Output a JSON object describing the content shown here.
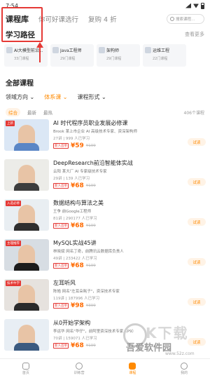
{
  "status": {
    "time": "7:54"
  },
  "header": {
    "tabs": [
      {
        "label": "课程库"
      },
      {
        "label": "你可好课选行"
      },
      {
        "label": "复购 4 折"
      }
    ],
    "search_placeholder": "搜索课程..."
  },
  "paths": {
    "title": "学习路径",
    "see_more": "查看更多",
    "cards": [
      {
        "name": "AI大模型前沿...",
        "count": "33门课程"
      },
      {
        "name": "Java工程师",
        "count": "29门课程"
      },
      {
        "name": "架构师",
        "count": "29门课程"
      },
      {
        "name": "运维工程",
        "count": "22门课程"
      }
    ]
  },
  "all_courses": {
    "title": "全部课程",
    "filters": [
      {
        "label": "领域方向 ⌄",
        "active": false
      },
      {
        "label": "体系课 ⌄",
        "active": true
      },
      {
        "label": "课程形式 ⌄",
        "active": false
      }
    ],
    "sort": [
      "综合",
      "最新",
      "最热"
    ],
    "count": "406个课程"
  },
  "courses": [
    {
      "title": "AI 时代程序员职业发展必修课",
      "teacher": "Brook  某上市企业 AI 高级技术专家、资深架构师",
      "meta": "27讲 | 999 人已学习",
      "badge": "新人首单",
      "price": "¥59",
      "orig": "¥199",
      "try": "试读",
      "tag": "上新",
      "colors": [
        "#dbe7f5",
        "#5a86c6"
      ]
    },
    {
      "title": "DeepResearch前沿智能体实战",
      "teacher": "云阳  某大厂 AI 专家级技术专家",
      "meta": "29讲 | 139 人已学习",
      "badge": "新人首单",
      "price": "¥68",
      "orig": "¥199",
      "try": "试读",
      "tag": "",
      "colors": [
        "#ecece8",
        "#3d3d3d"
      ]
    },
    {
      "title": "数据结构与算法之美",
      "teacher": "王争  前Google工程师",
      "meta": "81讲 | 290177 人已学习",
      "badge": "新人首单",
      "price": "¥68",
      "orig": "¥199",
      "try": "试读",
      "tag": "入选必修",
      "colors": [
        "#e9eef2",
        "#2f2f2f"
      ]
    },
    {
      "title": "MySQL实战45讲",
      "teacher": "林晓斌  网名丁奇，前腾讯云数据库负责人",
      "meta": "49讲 | 233422 人已学习",
      "badge": "新人首单",
      "price": "¥68",
      "orig": "¥199",
      "try": "试读",
      "tag": "主理推荐",
      "colors": [
        "#d7dde3",
        "#1c1c1c"
      ]
    },
    {
      "title": "左耳听风",
      "teacher": "陈皓  网名\"左耳朵耗子\"，资深技术专家",
      "meta": "119讲 | 187996 人已学习",
      "badge": "新人首单",
      "price": "¥98",
      "orig": "¥399",
      "try": "试读",
      "tag": "技术牛学",
      "colors": [
        "#e6e2de",
        "#2b2b2b"
      ]
    },
    {
      "title": "从0开始学架构",
      "teacher": "李运华  网名\"华仔\"，前阿里资深技术专家（P9）",
      "meta": "70讲 | 159071 人已学习",
      "badge": "新人首单",
      "price": "¥68",
      "orig": "¥199",
      "try": "试读",
      "tag": "",
      "colors": [
        "#e8eef4",
        "#3b5a80"
      ]
    }
  ],
  "bottom_nav": [
    {
      "label": "首页",
      "active": false
    },
    {
      "label": "训练营",
      "active": false
    },
    {
      "label": "课程",
      "active": true
    },
    {
      "label": "我的",
      "active": false
    }
  ],
  "watermark": {
    "big": "K下载",
    "cn": "吾爱软件园",
    "url": "www.52z.com"
  },
  "accent": "#ff8a00",
  "highlight": "#e53935"
}
